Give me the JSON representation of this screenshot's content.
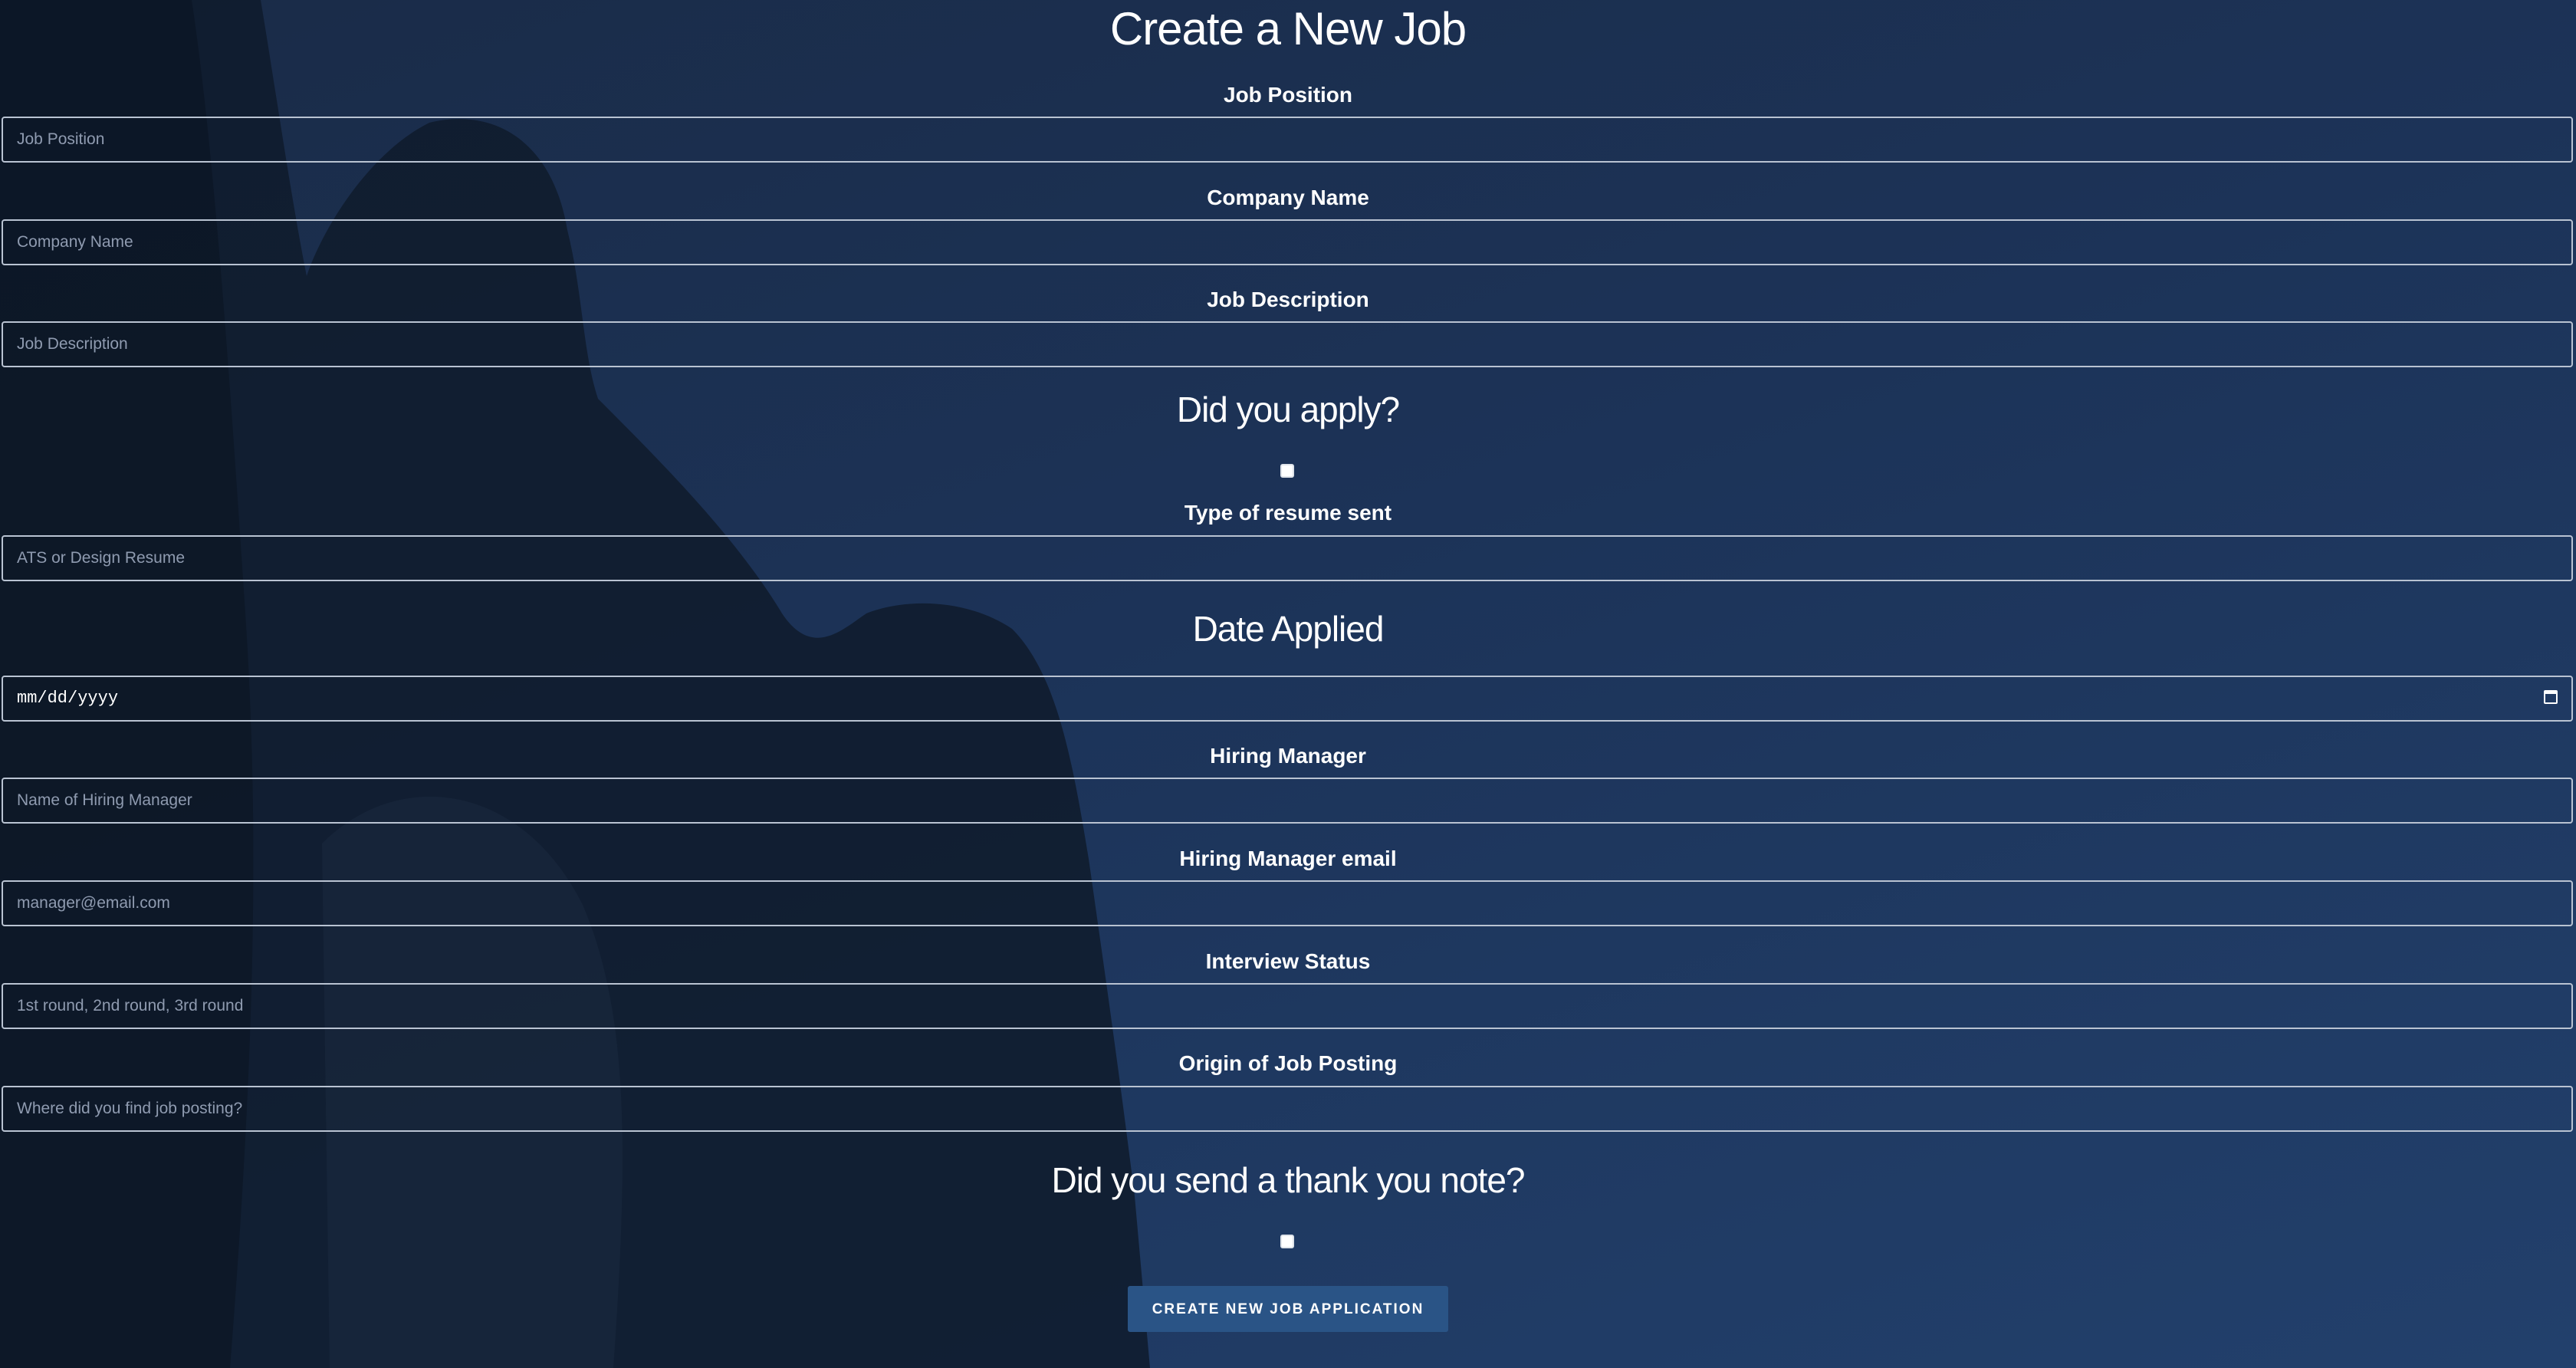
{
  "page": {
    "title": "Create a New Job"
  },
  "form": {
    "job_position": {
      "label": "Job Position",
      "placeholder": "Job Position",
      "value": ""
    },
    "company_name": {
      "label": "Company Name",
      "placeholder": "Company Name",
      "value": ""
    },
    "job_description": {
      "label": "Job Description",
      "placeholder": "Job Description",
      "value": ""
    },
    "applied": {
      "heading": "Did you apply?",
      "checked": false
    },
    "resume_type": {
      "label": "Type of resume sent",
      "placeholder": "ATS or Design Resume",
      "value": ""
    },
    "date_applied": {
      "heading": "Date Applied",
      "value": "mm/dd/yyyy",
      "icon": "calendar-icon"
    },
    "hiring_manager": {
      "label": "Hiring Manager",
      "placeholder": "Name of Hiring Manager",
      "value": ""
    },
    "hiring_manager_email": {
      "label": "Hiring Manager email",
      "placeholder": "manager@email.com",
      "value": ""
    },
    "interview_status": {
      "label": "Interview Status",
      "placeholder": "1st round, 2nd round, 3rd round",
      "value": ""
    },
    "job_origin": {
      "label": "Origin of Job Posting",
      "placeholder": "Where did you find job posting?",
      "value": ""
    },
    "thank_you_note": {
      "heading": "Did you send a thank you note?",
      "checked": false
    },
    "submit_label": "CREATE NEW JOB APPLICATION"
  },
  "colors": {
    "background_top": "#1a2b47",
    "background_bottom": "#22406c",
    "button": "#2a5486",
    "input_border": "#b9c3d2",
    "placeholder": "#8f9bb0"
  }
}
